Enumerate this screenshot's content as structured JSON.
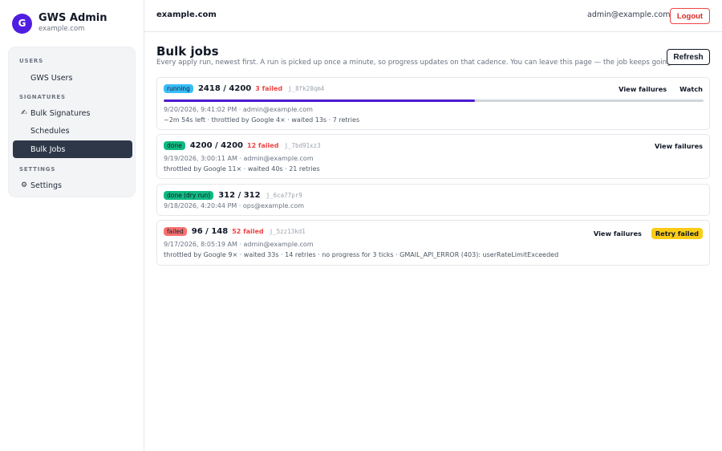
{
  "brand": {
    "initial": "G",
    "title": "GWS Admin",
    "subtitle": "example.com"
  },
  "sidebar": {
    "sections": [
      {
        "label": "USERS"
      },
      {
        "label": "SIGNATURES"
      },
      {
        "label": "SETTINGS"
      }
    ],
    "items": [
      {
        "label": "GWS Users",
        "icon": "users-icon",
        "glyph": ""
      },
      {
        "label": "Bulk Signatures",
        "icon": "pen-icon",
        "glyph": "✍"
      },
      {
        "label": "Schedules",
        "icon": "calendar-icon",
        "glyph": ""
      },
      {
        "label": "Bulk Jobs",
        "icon": "box-icon",
        "glyph": "",
        "active": true
      },
      {
        "label": "Settings",
        "icon": "gear-icon",
        "glyph": "⚙"
      }
    ]
  },
  "header": {
    "domain": "example.com",
    "user_icon": "user-icon",
    "user_glyph": "",
    "email": "admin@example.com",
    "logout_label": "Logout"
  },
  "main": {
    "title": "Bulk jobs",
    "description": "Every apply run, newest first. A run is picked up once a minute, so progress updates on that cadence. You can leave this page — the job keeps going.",
    "refresh_label": "Refresh"
  },
  "jobs": [
    {
      "status": "running",
      "progress": "2418 / 4200",
      "failed": "3 failed",
      "id": "j_8fk20qm4",
      "meta": "9/20/2026, 9:41:02 PM · admin@example.com",
      "detail": "~2m 54s left · throttled by Google 4× · waited 13s · 7 retries",
      "completion_fraction": 0.576,
      "actions": {
        "view_failures": "View failures",
        "watch": "Watch"
      }
    },
    {
      "status": "done",
      "progress": "4200 / 4200",
      "failed": "12 failed",
      "id": "j_7bd91xz3",
      "meta": "9/19/2026, 3:00:11 AM · admin@example.com",
      "detail": "throttled by Google 11× · waited 40s · 21 retries",
      "actions": {
        "view_failures": "View failures"
      }
    },
    {
      "status": "done (dry run)",
      "progress": "312 / 312",
      "id": "j_6ca77pr9",
      "meta": "9/18/2026, 4:20:44 PM · ops@example.com"
    },
    {
      "status": "failed",
      "progress": "96 / 148",
      "failed": "52 failed",
      "id": "j_5zz13kd1",
      "meta": "9/17/2026, 8:05:19 AM · admin@example.com",
      "detail": "throttled by Google 9× · waited 33s · 14 retries · no progress for 3 ticks · GMAIL_API_ERROR (403): userRateLimitExceeded",
      "actions": {
        "view_failures": "View failures",
        "retry": "Retry failed"
      }
    }
  ],
  "colors": {
    "accent": "#4f1ee0",
    "progress_fill": "#4c1ad1",
    "running": "#38bdf8",
    "done": "#10b981",
    "failed": "#f87171",
    "retry": "#facc15",
    "logout": "#dc2626"
  }
}
